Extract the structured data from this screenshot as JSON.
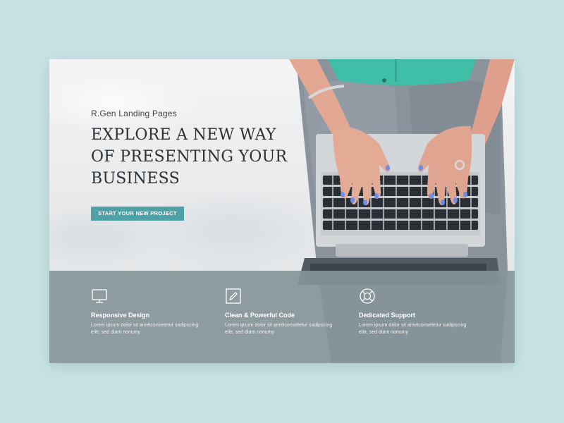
{
  "hero": {
    "brand": "R.Gen Landing Pages",
    "headline_line1": "EXPLORE A NEW WAY",
    "headline_line2": "OF PRESENTING YOUR",
    "headline_line3": "BUSINESS",
    "cta_label": "START YOUR NEW PROJECT"
  },
  "features": [
    {
      "icon": "monitor-icon",
      "title": "Responsive Design",
      "desc_line1": "Lorem ipsum dolor sit ametconsetetur sadipscing",
      "desc_line2": "elitr, sed diam nonumy"
    },
    {
      "icon": "pencil-icon",
      "title": "Clean & Powerful Code",
      "desc_line1": "Lorem ipsum dolor sit ametconsetetur sadipscing",
      "desc_line2": "elitr, sed diam nonumy"
    },
    {
      "icon": "lifebuoy-icon",
      "title": "Dedicated Support",
      "desc_line1": "Lorem ipsum dolor sit ametconsetetur sadipscing",
      "desc_line2": "elitr, sed diam nonumy"
    }
  ],
  "colors": {
    "page_background": "#c7e3e4",
    "accent": "#4fa1a8",
    "feature_band": "#869498",
    "headline_text": "#2c3135"
  }
}
